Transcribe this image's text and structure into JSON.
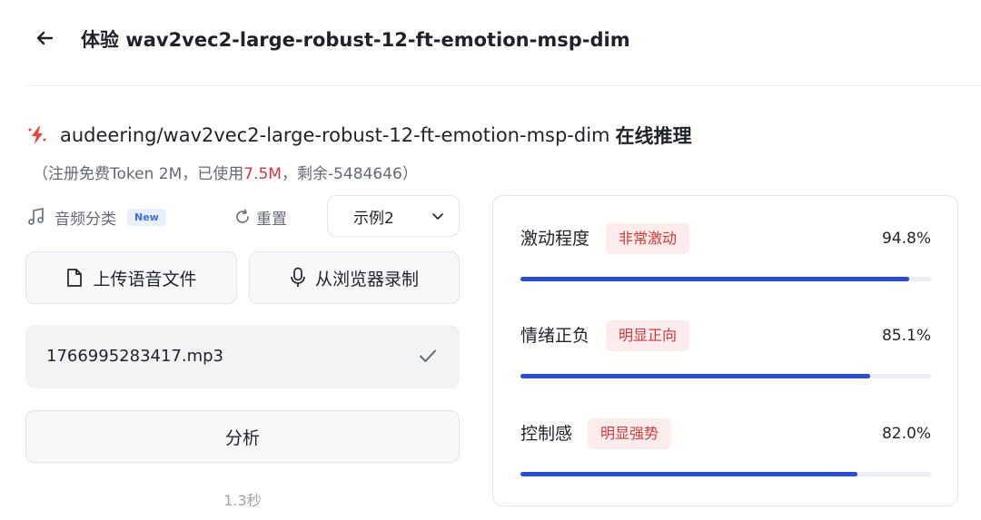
{
  "header": {
    "title": "体验 wav2vec2-large-robust-12-ft-emotion-msp-dim"
  },
  "model": {
    "name": "audeering/wav2vec2-large-robust-12-ft-emotion-msp-dim",
    "suffix": "在线推理"
  },
  "token": {
    "prefix": "（注册免费Token 2M，已使用",
    "used": "7.5M",
    "suffix": "，剩余-5484646）"
  },
  "tools": {
    "audio_class_label": "音频分类",
    "new_badge": "New",
    "reset_label": "重置",
    "example_selected": "示例2"
  },
  "actions": {
    "upload_label": "上传语音文件",
    "record_label": "从浏览器录制",
    "analyze_label": "分析"
  },
  "file": {
    "name": "1766995283417.mp3"
  },
  "elapsed": "1.3秒",
  "results": [
    {
      "name": "激动程度",
      "tag": "非常激动",
      "value_text": "94.8%",
      "fraction": 0.948
    },
    {
      "name": "情绪正负",
      "tag": "明显正向",
      "value_text": "85.1%",
      "fraction": 0.851
    },
    {
      "name": "控制感",
      "tag": "明显强势",
      "value_text": "82.0%",
      "fraction": 0.82
    }
  ],
  "colors": {
    "accent_red": "#d0383b",
    "bar_blue": "#2a4fce",
    "tag_bg": "#fdecec"
  },
  "icons": {
    "back": "back-arrow-icon",
    "model": "spark-icon",
    "audio": "music-note-icon",
    "reset": "refresh-icon",
    "dropdown": "chevron-down-icon",
    "upload": "file-icon",
    "record": "microphone-icon",
    "done": "check-icon"
  }
}
